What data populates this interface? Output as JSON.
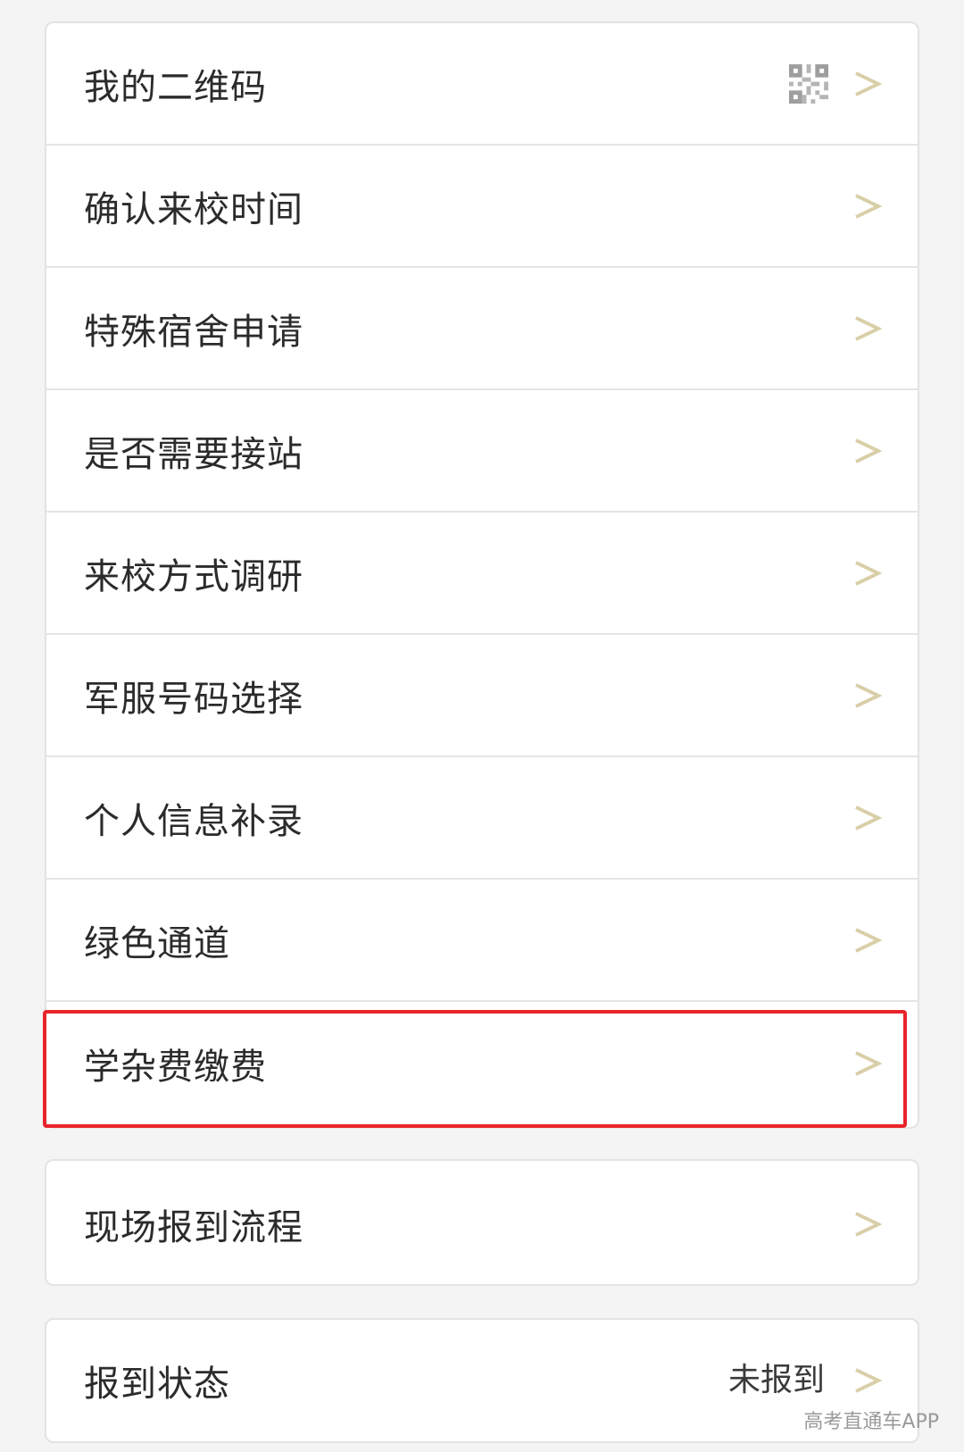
{
  "colors": {
    "chevron": "#d8cfa8",
    "highlight_border": "#e8242b",
    "label_text": "#2b2b2b",
    "background": "#f4f4f4"
  },
  "menu": {
    "items": [
      {
        "label": "我的二维码",
        "icon": "qr-code-icon"
      },
      {
        "label": "确认来校时间"
      },
      {
        "label": "特殊宿舍申请"
      },
      {
        "label": "是否需要接站"
      },
      {
        "label": "来校方式调研"
      },
      {
        "label": "军服号码选择"
      },
      {
        "label": "个人信息补录"
      },
      {
        "label": "绿色通道"
      },
      {
        "label": "学杂费缴费"
      }
    ]
  },
  "flow": {
    "label": "现场报到流程"
  },
  "status": {
    "label": "报到状态",
    "value": "未报到"
  },
  "watermark": "高考直通车APP"
}
